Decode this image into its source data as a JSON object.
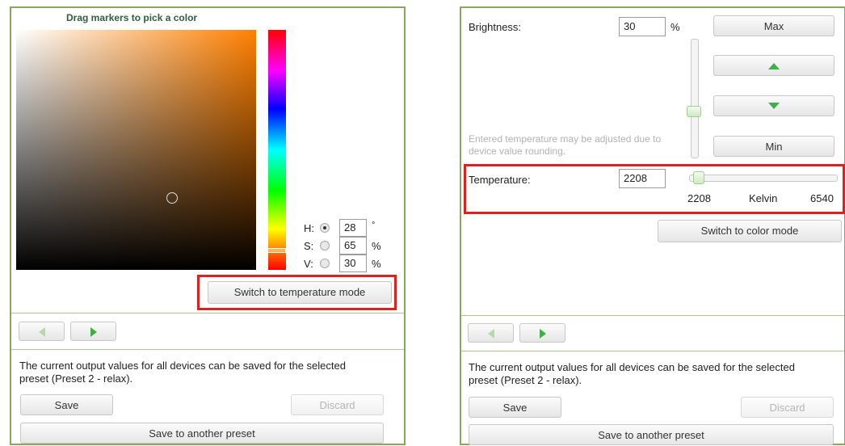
{
  "color_panel": {
    "title": "Drag markers to pick a color",
    "hue_label": "H:",
    "hue_value": "28",
    "hue_unit": "°",
    "sat_label": "S:",
    "sat_value": "65",
    "sat_unit": "%",
    "val_label": "V:",
    "val_value": "30",
    "val_unit": "%",
    "selected_component": "H",
    "switch_button": "Switch to temperature mode",
    "base_hue_color": "#ff8000"
  },
  "temp_panel": {
    "brightness_label": "Brightness:",
    "brightness_value": "30",
    "brightness_unit": "%",
    "brightness_level": 0.3,
    "max_button": "Max",
    "min_button": "Min",
    "up_icon": "triangle-up-icon",
    "down_icon": "triangle-down-icon",
    "note": "Entered temperature may be adjusted due to device value rounding.",
    "temperature_label": "Temperature:",
    "temperature_value": "2208",
    "temperature_min": "2208",
    "temperature_unit": "Kelvin",
    "temperature_max": "6540",
    "switch_button": "Switch to color mode"
  },
  "footer_left": {
    "message": "The current output values for all devices can be saved for the selected preset (Preset 2 - relax).",
    "save": "Save",
    "discard": "Discard",
    "save_another": "Save to another preset"
  },
  "footer_right": {
    "message": "The current output values for all devices can be saved for the selected preset (Preset 2 - relax).",
    "save": "Save",
    "discard": "Discard",
    "save_another": "Save to another preset"
  },
  "nav": {
    "prev_icon": "arrow-left-icon",
    "next_icon": "arrow-right-icon"
  },
  "colors": {
    "accent_green": "#8aa85c",
    "highlight_red": "#e02020",
    "nav_arrow_green": "#3cb043"
  }
}
